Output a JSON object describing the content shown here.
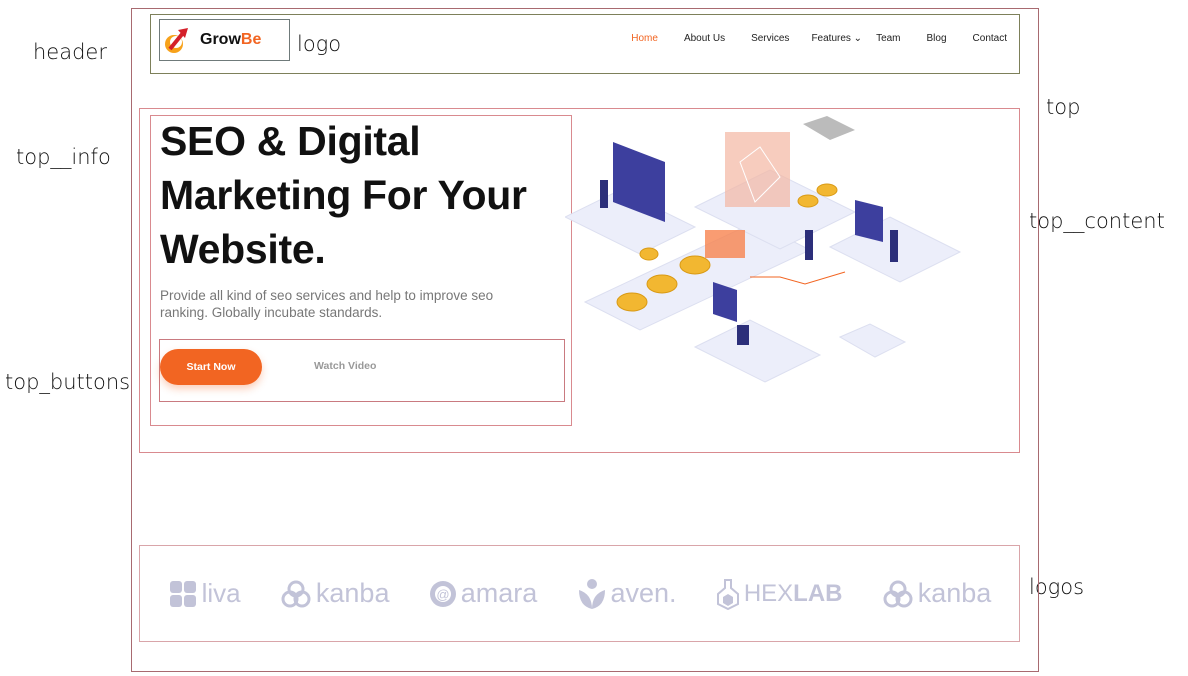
{
  "annotations": {
    "header": "header",
    "logo": "logo",
    "top": "top",
    "top_content": "top__content",
    "top_info": "top__info",
    "top_buttons": "top_buttons",
    "logos": "logos"
  },
  "brand": {
    "name_a": "Grow",
    "name_b": "Be",
    "accent": "#f26522"
  },
  "nav": [
    {
      "label": "Home",
      "active": true
    },
    {
      "label": "About Us"
    },
    {
      "label": "Services"
    },
    {
      "label": "Features ⌄"
    },
    {
      "label": "Team"
    },
    {
      "label": "Blog"
    },
    {
      "label": "Contact"
    }
  ],
  "hero": {
    "title": "SEO & Digital Marketing For Your Website.",
    "description": "Provide all kind of seo services and help to improve seo ranking. Globally incubate standards.",
    "start_label": "Start Now",
    "watch_label": "Watch Video"
  },
  "partners": [
    {
      "name": "liva"
    },
    {
      "name": "kanba"
    },
    {
      "name": "amara"
    },
    {
      "name": "aven."
    },
    {
      "name_a": "HEX",
      "name_b": "LAB"
    },
    {
      "name": "kanba"
    }
  ]
}
